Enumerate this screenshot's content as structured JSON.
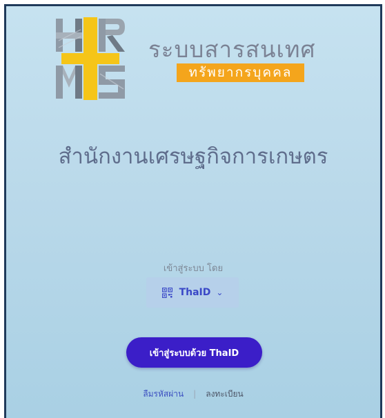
{
  "header": {
    "app_title": "ระบบสารสนเทศ",
    "app_subtitle": "ทรัพยากรบุคคล"
  },
  "logo": {
    "text": "HRMS"
  },
  "organization": {
    "name": "สำนักงานเศรษฐกิจการเกษตร"
  },
  "login": {
    "prompt": "เข้าสู่ระบบ โดย",
    "provider": "ThaID",
    "submit_label": "เข้าสู่ระบบด้วย ThaID",
    "forgot_password": "ลืมรหัสผ่าน",
    "separator": "|",
    "register": "ลงทะเบียน"
  },
  "colors": {
    "accent": "#3b1ec8",
    "subtitle_bg": "#f4a51c",
    "logo_yellow": "#f5c518",
    "logo_gray": "#8f9aa6"
  },
  "icons": {
    "provider": "qr-code-icon",
    "dropdown": "chevron-down-icon"
  }
}
